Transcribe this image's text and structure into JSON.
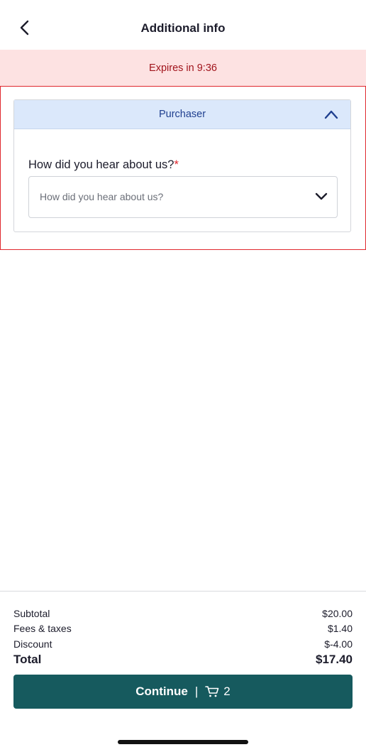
{
  "header": {
    "title": "Additional info",
    "back_icon": "chevron-left-icon"
  },
  "timer": {
    "text": "Expires in 9:36"
  },
  "section": {
    "title": "Purchaser",
    "collapse_icon": "chevron-up-icon",
    "question": {
      "label": "How did you hear about us?",
      "required_mark": "*",
      "placeholder": "How did you hear about us?",
      "dropdown_icon": "chevron-down-icon"
    }
  },
  "summary": {
    "subtotal_label": "Subtotal",
    "subtotal_value": "$20.00",
    "fees_label": "Fees & taxes",
    "fees_value": "$1.40",
    "discount_label": "Discount",
    "discount_value": "$-4.00",
    "total_label": "Total",
    "total_value": "$17.40"
  },
  "continue_button": {
    "label": "Continue",
    "separator": "|",
    "cart_icon": "cart-icon",
    "cart_count": "2"
  },
  "colors": {
    "accent": "#165a5e",
    "banner_bg": "#fde2e2",
    "banner_text": "#a1141c",
    "section_header_bg": "#dbe8fb",
    "highlight_border": "#e0282e"
  }
}
